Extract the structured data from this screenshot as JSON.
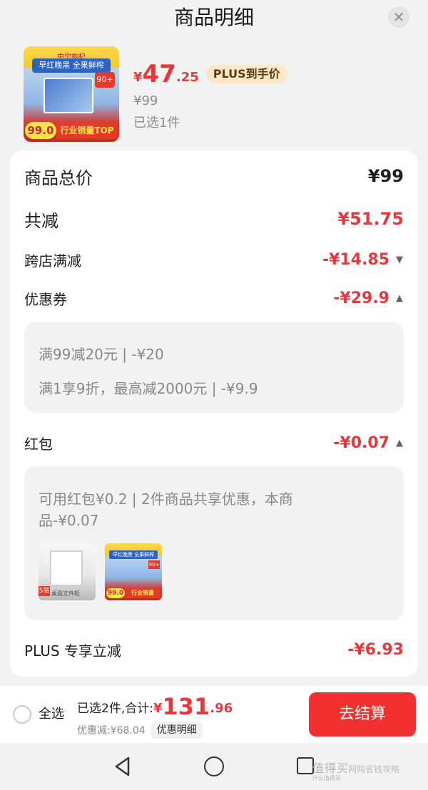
{
  "header": {
    "title": "商品明细",
    "close_symbol": "✕"
  },
  "product": {
    "thumb": {
      "brand": "中宁枸杞",
      "slogan": "早红晚黑 全果鲜榨",
      "badge": "90+",
      "price_badge": "99.0",
      "top_badge": "行业销量TOP"
    },
    "price_symbol": "¥",
    "price_int": "47",
    "price_dec": ".25",
    "plus_tag": "PLUS到手价",
    "original_price": "¥99",
    "selected_count": "已选1件"
  },
  "summary": {
    "total": {
      "label": "商品总价",
      "value": "¥99"
    },
    "reduction": {
      "label": "共减",
      "value": "¥51.75"
    },
    "cross_store": {
      "label": "跨店满减",
      "value": "-¥14.85"
    },
    "coupon": {
      "label": "优惠券",
      "value": "-¥29.9",
      "details": [
        "满99减20元 | -¥20",
        "满1享9折，最高减2000元 | -¥9.9"
      ]
    },
    "red_packet": {
      "label": "红包",
      "value": "-¥0.07",
      "detail_lines": [
        "可用红包¥0.2 | 2件商品共享优惠，本商",
        "品-¥0.07"
      ],
      "thumbs": [
        {
          "tag": "5层",
          "caption": "桌面文件柜"
        },
        {
          "slogan": "早红晚黑 全果鲜榨",
          "badge": "90+",
          "price_badge": "99.0",
          "top_badge": "行业销量TOP"
        }
      ]
    },
    "plus": {
      "label": "PLUS 专享立减",
      "value": "-¥6.93"
    }
  },
  "bottom": {
    "select_all": "全选",
    "sum_label": "已选2件,合计:",
    "sum_symbol": "¥",
    "sum_int": "131",
    "sum_dec": ".96",
    "discount_text": "优惠减:¥68.04",
    "detail_button": "优惠明细",
    "checkout_button": "去结算"
  },
  "watermark": {
    "text": "值得买",
    "sub": "什么值得买",
    "right": "网购省钱攻略"
  },
  "colors": {
    "accent_red": "#e4393c",
    "checkout_red": "#f23030",
    "plus_tag_bg": "#fbe6c6"
  },
  "icons": [
    "close-icon",
    "chevron-down-icon",
    "chevron-up-icon",
    "back-icon",
    "home-icon",
    "recent-apps-icon"
  ]
}
